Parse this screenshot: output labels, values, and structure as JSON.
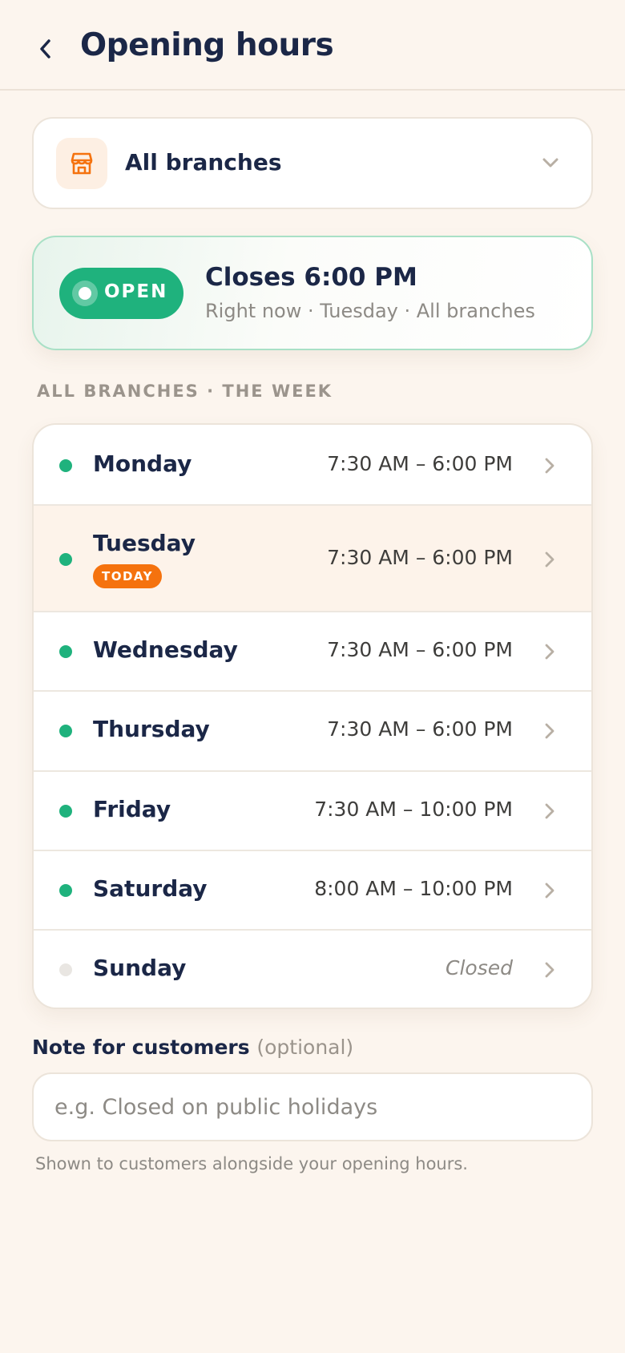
{
  "header": {
    "title": "Opening hours",
    "back_icon": "chevron-left-icon"
  },
  "branch_selector": {
    "label": "All branches",
    "icon": "store-icon",
    "chevron_icon": "chevron-down-icon"
  },
  "status": {
    "badge": "OPEN",
    "title": "Closes 6:00 PM",
    "subtitle": "Right now · Tuesday · All branches"
  },
  "week": {
    "section_label": "ALL BRANCHES · THE WEEK",
    "days": [
      {
        "name": "Monday",
        "hours": "7:30 AM – 6:00 PM",
        "open": true,
        "today": false
      },
      {
        "name": "Tuesday",
        "hours": "7:30 AM – 6:00 PM",
        "open": true,
        "today": true,
        "today_badge": "TODAY"
      },
      {
        "name": "Wednesday",
        "hours": "7:30 AM – 6:00 PM",
        "open": true,
        "today": false
      },
      {
        "name": "Thursday",
        "hours": "7:30 AM – 6:00 PM",
        "open": true,
        "today": false
      },
      {
        "name": "Friday",
        "hours": "7:30 AM – 10:00 PM",
        "open": true,
        "today": false
      },
      {
        "name": "Saturday",
        "hours": "8:00 AM – 10:00 PM",
        "open": true,
        "today": false
      },
      {
        "name": "Sunday",
        "hours": "Closed",
        "open": false,
        "today": false
      }
    ]
  },
  "note": {
    "label": "Note for customers",
    "optional": "(optional)",
    "placeholder": "e.g. Closed on public holidays",
    "value": "",
    "helper": "Shown to customers alongside your opening hours."
  },
  "colors": {
    "background": "#fcf5ee",
    "accent_green": "#1fb27d",
    "accent_orange": "#f5720e",
    "text_primary": "#1b2747",
    "text_muted": "#8d8a85"
  }
}
